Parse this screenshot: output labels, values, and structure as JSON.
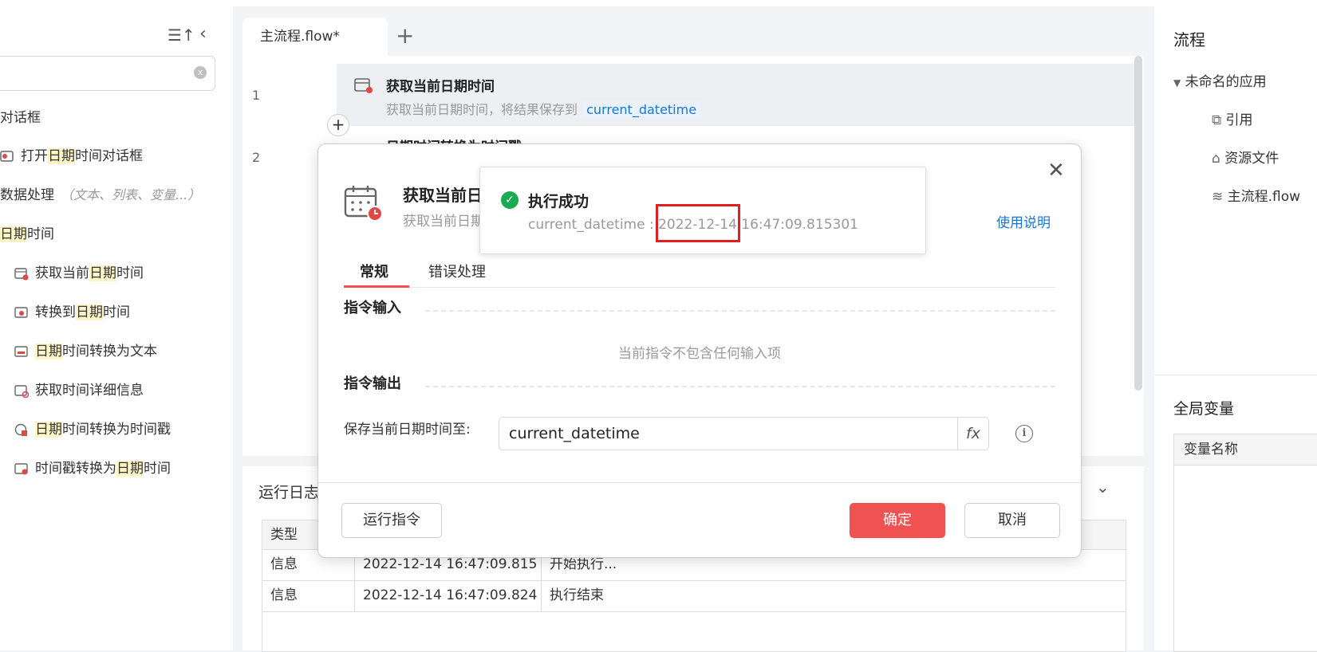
{
  "left_panel": {
    "search_clear": "x",
    "tree": [
      {
        "pre": "对话框",
        "hl": "",
        "post": "",
        "hint": ""
      },
      {
        "pre": "打开",
        "hl": "日期",
        "post": "时间对话框",
        "hint": ""
      },
      {
        "pre": "数据处理",
        "hl": "",
        "post": "",
        "hint": "（文本、列表、变量...）"
      },
      {
        "pre": "",
        "hl": "日期",
        "post": "时间",
        "hint": ""
      },
      {
        "pre": "获取当前",
        "hl": "日期",
        "post": "时间",
        "hint": ""
      },
      {
        "pre": "转换到",
        "hl": "日期",
        "post": "时间",
        "hint": ""
      },
      {
        "pre": "",
        "hl": "日期",
        "post": "时间转换为文本",
        "hint": ""
      },
      {
        "pre": "获取时间详细信息",
        "hl": "",
        "post": "",
        "hint": ""
      },
      {
        "pre": "",
        "hl": "日期",
        "post": "时间转换为时间戳",
        "hint": ""
      },
      {
        "pre": "时间戳转换为",
        "hl": "日期",
        "post": "时间",
        "hint": ""
      }
    ]
  },
  "editor": {
    "tab_label": "主流程.flow*",
    "tab_add": "+",
    "line1": "1",
    "line2": "2",
    "step1_title": "获取当前日期时间",
    "step1_desc": "获取当前日期时间，将结果保存到",
    "step1_var": "current_datetime",
    "step2_title": "日期时间转换为时间戳",
    "add_step": "+"
  },
  "log": {
    "title": "运行日志",
    "header_type": "类型",
    "rows": [
      {
        "type": "信息",
        "time": "2022-12-14 16:47:09.815",
        "msg": "开始执行..."
      },
      {
        "type": "信息",
        "time": "2022-12-14 16:47:09.824",
        "msg": "执行结束"
      }
    ]
  },
  "right_panel": {
    "title": "流程",
    "app_name": "未命名的应用",
    "items": [
      "引用",
      "资源文件",
      "主流程.flow"
    ],
    "globals_title": "全局变量",
    "var_col": "变量名称"
  },
  "dialog": {
    "title": "获取当前日期时间",
    "desc": "获取当前日期时间，将结果保存到变量中",
    "help": "使用说明",
    "tab_normal": "常规",
    "tab_error": "错误处理",
    "input_section": "指令输入",
    "empty_input": "当前指令不包含任何输入项",
    "output_section": "指令输出",
    "output_label": "保存当前日期时间至:",
    "output_value": "current_datetime",
    "fx": "fx",
    "info": "i",
    "run_btn": "运行指令",
    "ok_btn": "确定",
    "cancel_btn": "取消"
  },
  "toast": {
    "check": "✓",
    "title": "执行成功",
    "msg": "current_datetime : 2022-12-14 16:47:09.815301"
  },
  "colors": {
    "accent": "#f05252",
    "link": "#1677d9",
    "success": "#1aab52"
  }
}
